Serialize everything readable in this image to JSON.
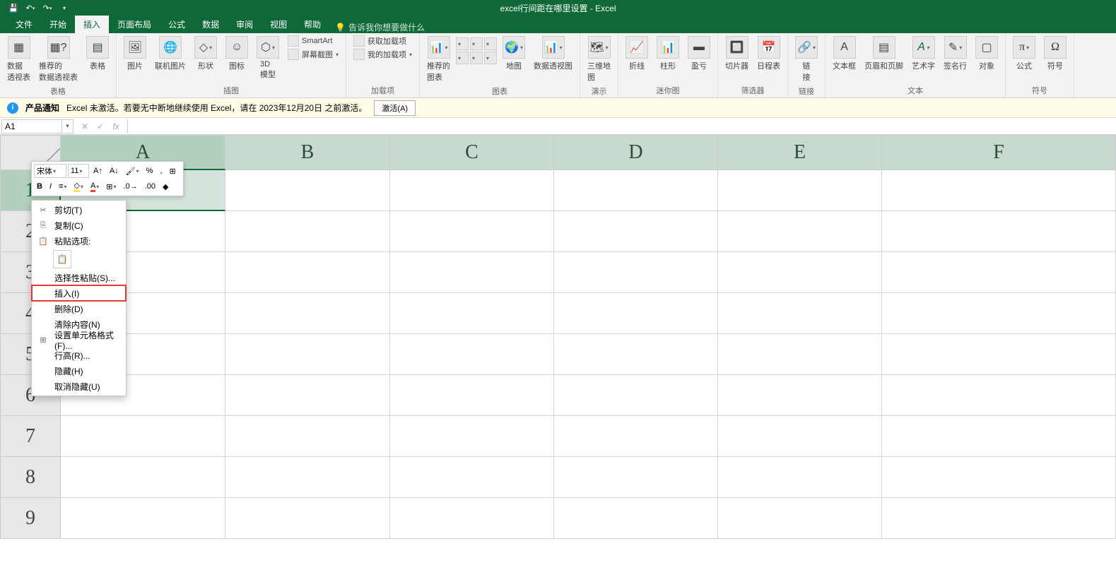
{
  "titlebar": {
    "title": "excel行间距在哪里设置 - Excel"
  },
  "tabs": {
    "file": "文件",
    "home": "开始",
    "insert": "插入",
    "pagelayout": "页面布局",
    "formulas": "公式",
    "data": "数据",
    "review": "审阅",
    "view": "视图",
    "help": "帮助",
    "tellme": "告诉我你想要做什么"
  },
  "ribbon": {
    "groups": {
      "tables": "表格",
      "illustrations": "插图",
      "addins": "加载项",
      "charts": "图表",
      "tours": "演示",
      "sparklines": "迷你图",
      "filters": "筛选器",
      "links": "链接",
      "text": "文本",
      "symbols": "符号"
    },
    "buttons": {
      "pivot": "数据\n透视表",
      "recpivot": "推荐的\n数据透视表",
      "table": "表格",
      "pictures": "图片",
      "onlinepic": "联机图片",
      "shapes": "形状",
      "icons": "图标",
      "model3d": "3D\n模型",
      "smartart": "SmartArt",
      "screenshot": "屏幕截图",
      "getaddins": "获取加载项",
      "myaddins": "我的加载项",
      "reccharts": "推荐的\n图表",
      "maps": "地图",
      "pivotchart": "数据透视图",
      "map3d": "三维地\n图",
      "line": "折线",
      "column": "柱形",
      "winloss": "盈亏",
      "slicer": "切片器",
      "timeline": "日程表",
      "link": "链\n接",
      "textbox": "文本框",
      "headerfooter": "页眉和页脚",
      "wordart": "艺术字",
      "sigline": "签名行",
      "object": "对象",
      "equation": "公式",
      "symbol": "符号"
    }
  },
  "notice": {
    "label": "产品通知",
    "text": "Excel 未激活。若要无中断地继续使用 Excel，请在 2023年12月20日 之前激活。",
    "button": "激活(A)"
  },
  "namebox": "A1",
  "columns": [
    "A",
    "B",
    "C",
    "D",
    "E",
    "F"
  ],
  "rows": [
    "1",
    "2",
    "3",
    "4",
    "5",
    "6",
    "7",
    "8",
    "9"
  ],
  "miniToolbar": {
    "font": "宋体",
    "size": "11"
  },
  "contextMenu": {
    "cut": "剪切(T)",
    "copy": "复制(C)",
    "pasteLabel": "粘贴选项:",
    "pasteSpecial": "选择性粘贴(S)...",
    "insert": "插入(I)",
    "delete": "删除(D)",
    "clear": "清除内容(N)",
    "format": "设置单元格格式(F)...",
    "rowheight": "行高(R)...",
    "hide": "隐藏(H)",
    "unhide": "取消隐藏(U)"
  }
}
